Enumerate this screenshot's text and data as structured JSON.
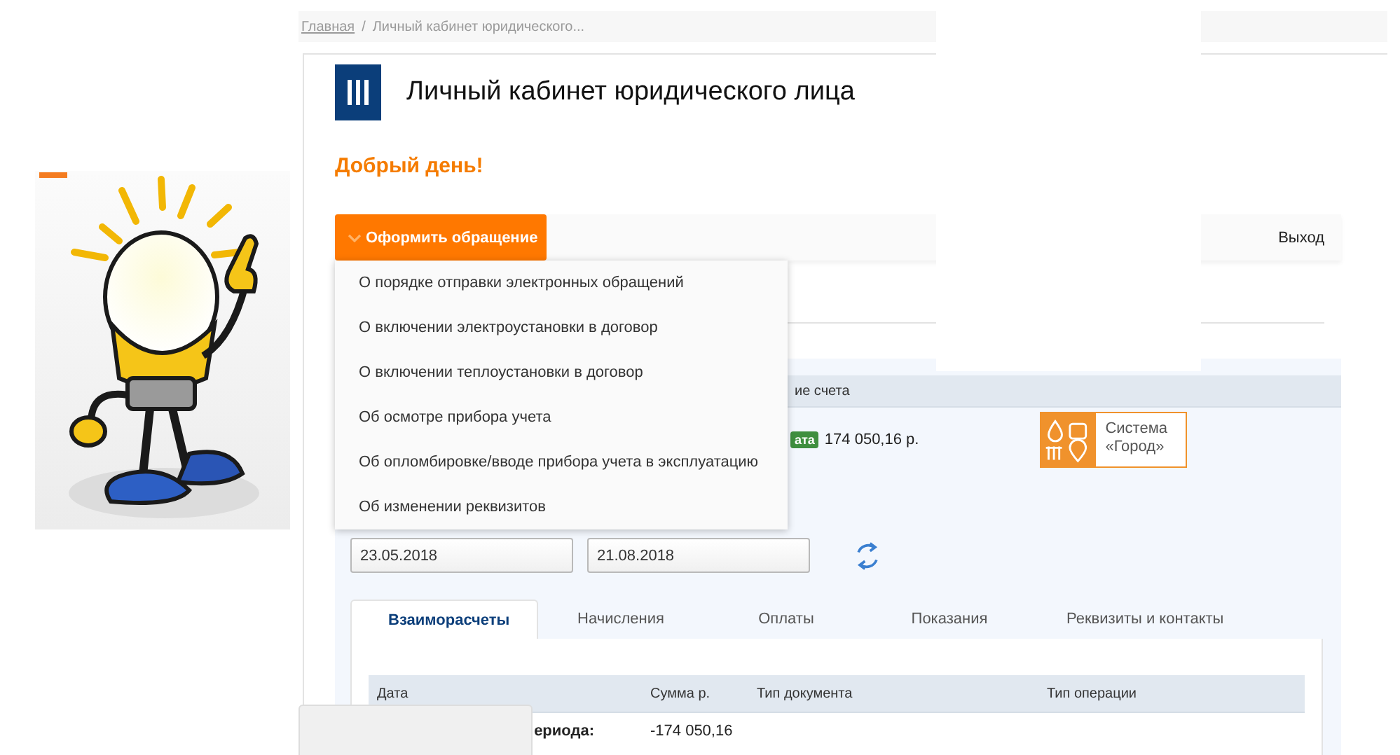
{
  "breadcrumb": [
    {
      "label": "Главная",
      "kind": "link"
    },
    {
      "label": "Личный кабинет юридического...",
      "kind": "current"
    }
  ],
  "breadcrumb_separator": "/",
  "header": {
    "title": "Личный кабинет юридического лица"
  },
  "greeting": "Добрый день!",
  "toolbar": {
    "action_button": "Оформить обращение",
    "logout": "Выход"
  },
  "dropdown": {
    "items": [
      "О порядке отправки электронных обращений",
      "О включении электроустановки в договор",
      "О включении теплоустановки в договор",
      "Об осмотре прибора учета",
      "Об опломбировке/вводе прибора учета в эксплуатацию",
      "Об изменении реквизитов"
    ]
  },
  "account": {
    "header": "ие счета",
    "badge": "ата",
    "amount": "174 050,16 р.",
    "partner_logo": {
      "line1": "Система",
      "line2": "«Город»"
    }
  },
  "period": {
    "from": "23.05.2018",
    "to": "21.08.2018"
  },
  "tabs": [
    {
      "label": "Взаиморасчеты",
      "selected": true
    },
    {
      "label": "Начисления",
      "selected": false
    },
    {
      "label": "Оплаты",
      "selected": false
    },
    {
      "label": "Показания",
      "selected": false
    },
    {
      "label": "Реквизиты и контакты",
      "selected": false
    }
  ],
  "table": {
    "columns": [
      "Дата",
      "Сумма р.",
      "Тип документа",
      "Тип операции"
    ],
    "rows": [
      [
        "ериода:",
        "-174 050,16",
        "",
        ""
      ]
    ]
  }
}
